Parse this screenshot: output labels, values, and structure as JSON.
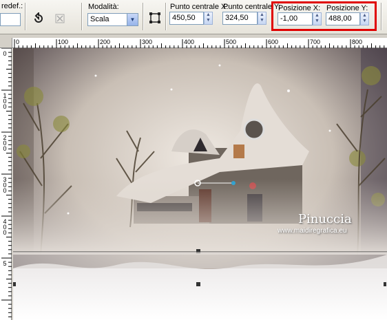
{
  "toolbar": {
    "preset_label": "redef.:",
    "mode_label": "Modalità:",
    "mode_value": "Scala",
    "center_x_label": "Punto centrale X:",
    "center_x_value": "450,50",
    "center_y_label": "Punto centrale Y:",
    "center_y_value": "324,50",
    "pos_x_label": "Posizione X:",
    "pos_x_value": "-1,00",
    "pos_y_label": "Posizione Y:",
    "pos_y_value": "488,00"
  },
  "ruler": {
    "top_labels": [
      "0",
      "100",
      "200",
      "300",
      "400",
      "500",
      "600",
      "700",
      "800"
    ],
    "left_labels": [
      "0",
      "1\n0\n0",
      "2\n0\n0",
      "3\n0\n0",
      "4\n0\n0",
      "5"
    ]
  },
  "watermark": {
    "name": "Pinuccia",
    "site": "www.maidiregrafica.eu"
  },
  "colors": {
    "highlight": "#e00000",
    "toolbar_bg": "#ece9d8",
    "input_border": "#7f9db9"
  }
}
